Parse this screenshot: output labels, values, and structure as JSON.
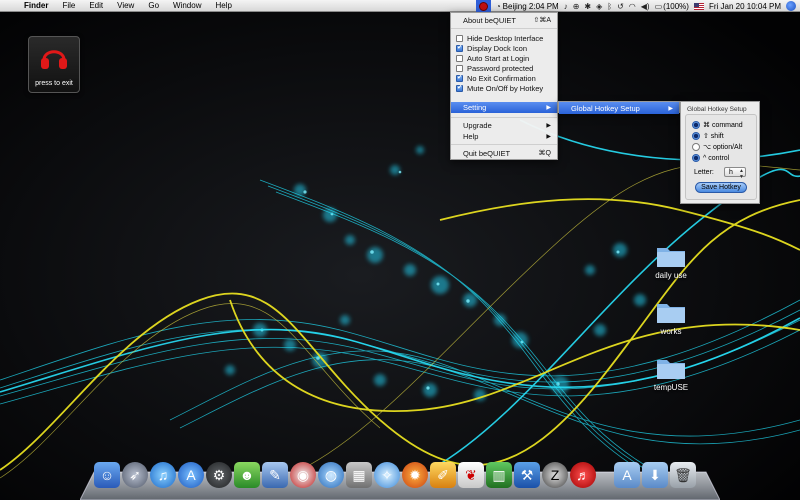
{
  "menubar": {
    "app_name": "Finder",
    "menus": [
      "File",
      "Edit",
      "View",
      "Go",
      "Window",
      "Help"
    ],
    "clock_city": "Beijing 2:04 PM",
    "battery": "(100%)",
    "datetime": "Fri Jan 20  10:04 PM"
  },
  "widget": {
    "label": "press to exit"
  },
  "bequiet_menu": {
    "about": "About beQUIET",
    "about_shortcut": "⇧⌘A",
    "options": [
      {
        "label": "Hide Desktop Interface",
        "checked": false
      },
      {
        "label": "Display Dock Icon",
        "checked": true
      },
      {
        "label": "Auto Start at Login",
        "checked": false
      },
      {
        "label": "Password protected",
        "checked": false
      },
      {
        "label": "No Exit Confirmation",
        "checked": true
      },
      {
        "label": "Mute On/Off by Hotkey",
        "checked": true
      }
    ],
    "setting": "Setting",
    "upgrade": "Upgrade",
    "help": "Help",
    "quit": "Quit beQUIET",
    "quit_shortcut": "⌘Q"
  },
  "submenu": {
    "global_hotkey": "Global Hotkey Setup"
  },
  "hotkey_panel": {
    "title": "Global Hotkey Setup",
    "modifiers": [
      {
        "label": "⌘ command",
        "checked": true
      },
      {
        "label": "⇧ shift",
        "checked": true
      },
      {
        "label": "⌥ option/Alt",
        "checked": false
      },
      {
        "label": "^ control",
        "checked": true
      }
    ],
    "letter_label": "Letter:",
    "letter_value": "h",
    "save_label": "Save Hotkey"
  },
  "desktop": {
    "folders": [
      "daily use",
      "works",
      "tempUSE"
    ]
  },
  "colors": {
    "accent": "#2a62d8",
    "wave_cyan": "#20d8f0",
    "wave_yellow": "#e8e020"
  }
}
